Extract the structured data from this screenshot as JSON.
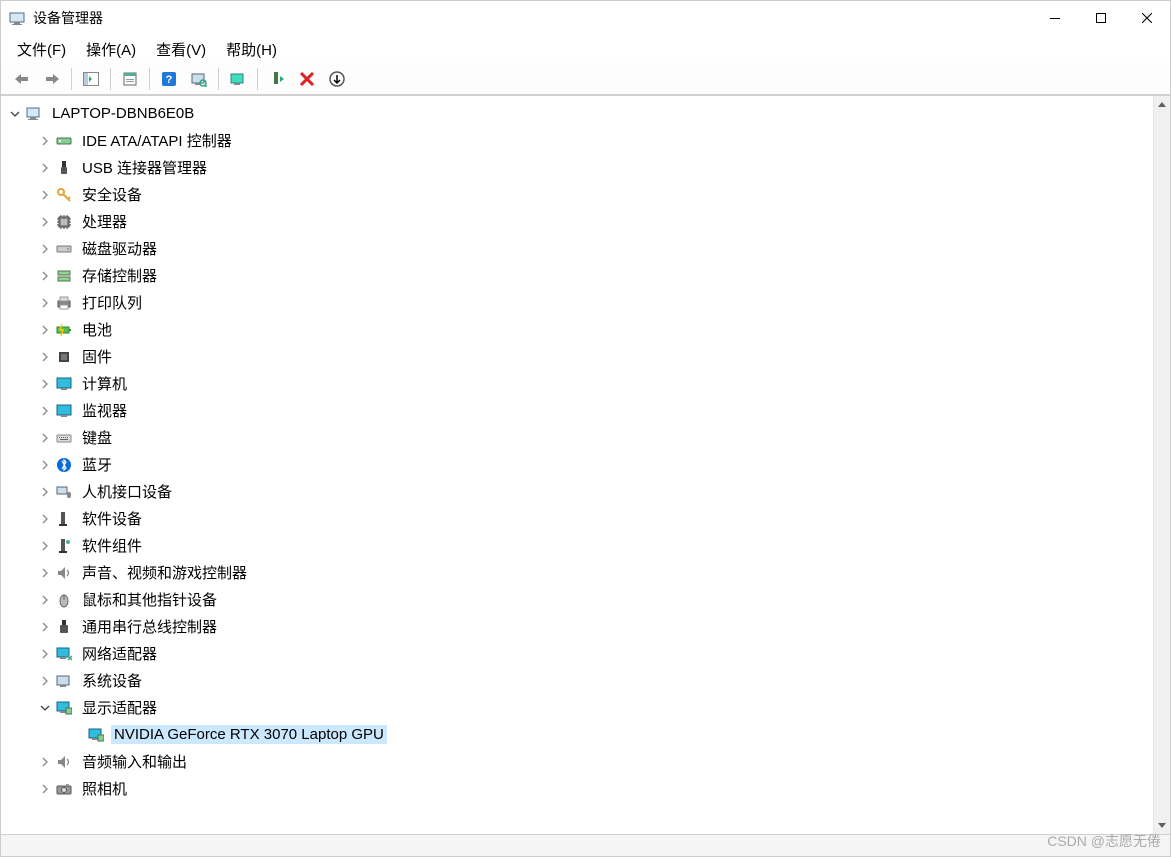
{
  "title": "设备管理器",
  "menu": {
    "file": "文件(F)",
    "action": "操作(A)",
    "view": "查看(V)",
    "help": "帮助(H)"
  },
  "toolbar": {
    "back": "back",
    "forward": "forward",
    "show_hide": "show-hide-console-tree",
    "properties": "properties",
    "help": "help",
    "scan": "scan-hardware-changes",
    "monitor": "view",
    "enable": "enable-device",
    "uninstall": "uninstall-device",
    "add_legacy": "add-legacy-hardware"
  },
  "tree": {
    "root": {
      "label": "LAPTOP-DBNB6E0B",
      "expanded": true,
      "icon": "computer"
    },
    "categories": [
      {
        "label": "IDE ATA/ATAPI 控制器",
        "icon": "ide",
        "expanded": false
      },
      {
        "label": "USB 连接器管理器",
        "icon": "usb-plug",
        "expanded": false
      },
      {
        "label": "安全设备",
        "icon": "key",
        "expanded": false
      },
      {
        "label": "处理器",
        "icon": "cpu",
        "expanded": false
      },
      {
        "label": "磁盘驱动器",
        "icon": "disk",
        "expanded": false
      },
      {
        "label": "存储控制器",
        "icon": "storage",
        "expanded": false
      },
      {
        "label": "打印队列",
        "icon": "printer",
        "expanded": false
      },
      {
        "label": "电池",
        "icon": "battery",
        "expanded": false
      },
      {
        "label": "固件",
        "icon": "firmware",
        "expanded": false
      },
      {
        "label": "计算机",
        "icon": "monitor",
        "expanded": false
      },
      {
        "label": "监视器",
        "icon": "monitor",
        "expanded": false
      },
      {
        "label": "键盘",
        "icon": "keyboard",
        "expanded": false
      },
      {
        "label": "蓝牙",
        "icon": "bluetooth",
        "expanded": false
      },
      {
        "label": "人机接口设备",
        "icon": "hid",
        "expanded": false
      },
      {
        "label": "软件设备",
        "icon": "software-device",
        "expanded": false
      },
      {
        "label": "软件组件",
        "icon": "software-component",
        "expanded": false
      },
      {
        "label": "声音、视频和游戏控制器",
        "icon": "audio",
        "expanded": false
      },
      {
        "label": "鼠标和其他指针设备",
        "icon": "mouse",
        "expanded": false
      },
      {
        "label": "通用串行总线控制器",
        "icon": "usb",
        "expanded": false
      },
      {
        "label": "网络适配器",
        "icon": "network",
        "expanded": false
      },
      {
        "label": "系统设备",
        "icon": "system",
        "expanded": false
      },
      {
        "label": "显示适配器",
        "icon": "display",
        "expanded": true,
        "children": [
          {
            "label": "NVIDIA GeForce RTX 3070 Laptop GPU",
            "icon": "gpu",
            "selected": true
          }
        ]
      },
      {
        "label": "音频输入和输出",
        "icon": "audio-io",
        "expanded": false
      },
      {
        "label": "照相机",
        "icon": "camera",
        "expanded": false
      }
    ]
  },
  "watermark": "CSDN @志愿无倦"
}
